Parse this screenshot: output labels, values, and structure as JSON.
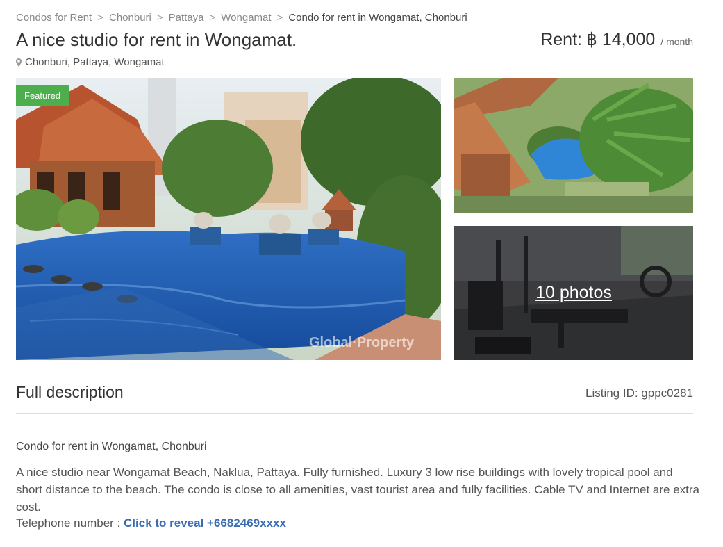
{
  "breadcrumb": {
    "items": [
      "Condos for Rent",
      "Chonburi",
      "Pattaya",
      "Wongamat"
    ],
    "separator": ">",
    "current": "Condo for rent in Wongamat, Chonburi"
  },
  "listing": {
    "title": "A nice studio for rent in Wongamat.",
    "location": "Chonburi, Pattaya, Wongamat",
    "rent_label": "Rent:",
    "rent_value": "฿ 14,000",
    "rent_period": "/ month"
  },
  "gallery": {
    "badge": "Featured",
    "photos_link": "10 photos",
    "watermark": "Global·Property",
    "badge_color": "#4cae4c"
  },
  "description": {
    "heading": "Full description",
    "listing_id": "Listing ID: gppc0281",
    "subtitle": "Condo for rent in Wongamat, Chonburi",
    "body": "A nice studio near Wongamat Beach, Naklua, Pattaya. Fully furnished. Luxury 3 low rise buildings with lovely tropical pool and short distance to the beach. The condo is close to all amenities, vast tourist area and fully facilities. Cable TV and Internet are extra cost.",
    "phone_label": "Telephone number :",
    "phone_reveal": "Click to reveal +6682469xxxx",
    "link_color": "#3a6cb4"
  },
  "icons": {
    "location": "map-marker-icon"
  }
}
